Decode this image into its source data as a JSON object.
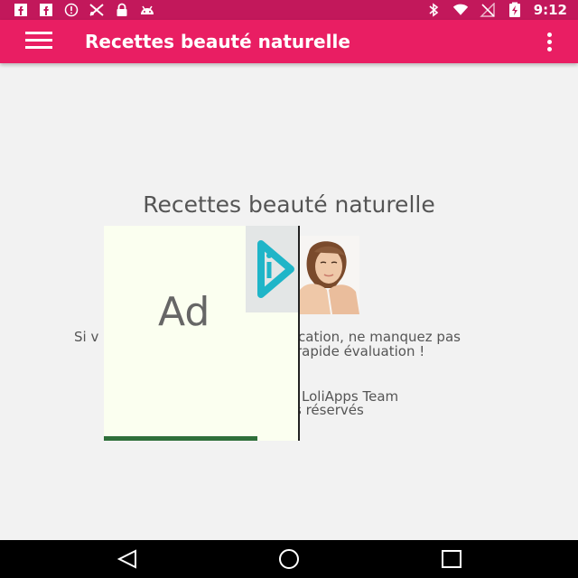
{
  "status_bar": {
    "time": "9:12",
    "icons": [
      "facebook-icon",
      "facebook-icon",
      "info-icon",
      "cut-tool-icon",
      "lock-icon",
      "android-icon",
      "bluetooth-icon",
      "wifi-icon",
      "no-signal-icon",
      "battery-charging-icon"
    ]
  },
  "app_bar": {
    "title": "Recettes beauté naturelle",
    "menu_icon": "hamburger-menu-icon",
    "overflow_icon": "more-vert-icon"
  },
  "content": {
    "title": "Recettes beauté naturelle",
    "message_line1": "Si v",
    "message_line1_end": "cation, ne manquez pas",
    "message_line2_end": "rapide évaluation !",
    "credit_line1": "LoliApps Team",
    "credit_line2": "s réservés"
  },
  "ad": {
    "label": "Ad",
    "choices_icon": "play-arrow-icon"
  },
  "nav_bar": {
    "back_icon": "back-triangle-icon",
    "home_icon": "home-circle-icon",
    "recents_icon": "recents-square-icon"
  },
  "colors": {
    "status_bar": "#c2185b",
    "app_bar": "#e91e63",
    "background": "#f2f2f2"
  }
}
